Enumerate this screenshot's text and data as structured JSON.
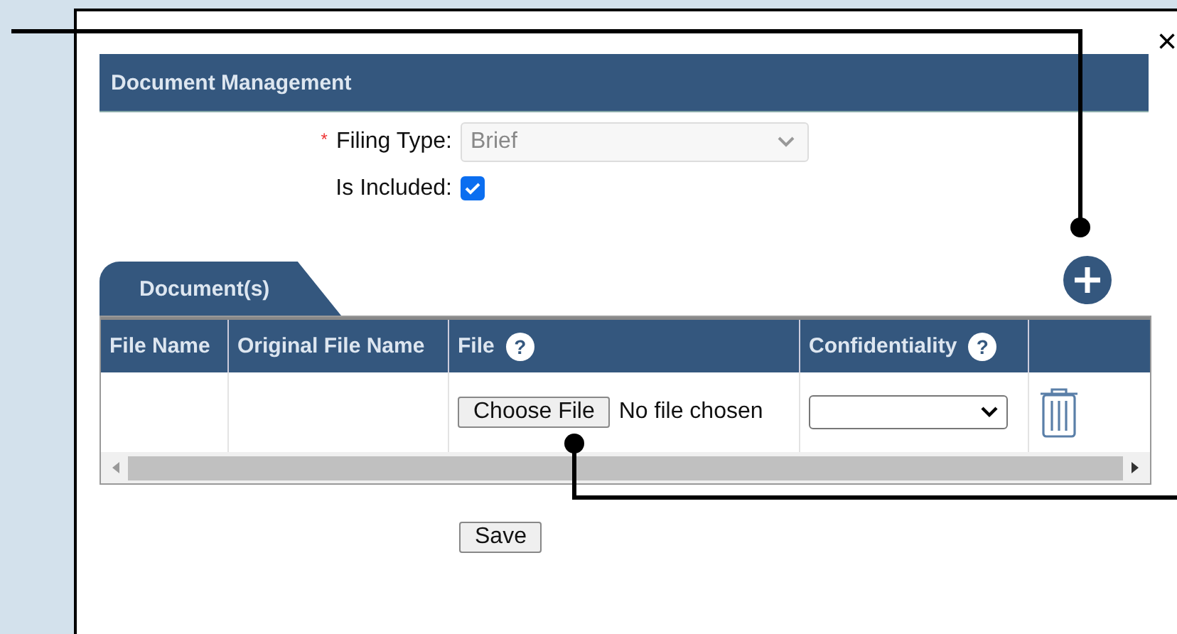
{
  "dialog": {
    "close": "×",
    "title": "Document Management"
  },
  "form": {
    "filing_type": {
      "label": "Filing Type:",
      "required_mark": "*",
      "value": "Brief",
      "disabled": true
    },
    "is_included": {
      "label": "Is Included:",
      "checked": true
    }
  },
  "tabs": [
    {
      "label": "Document(s)",
      "selected": true
    }
  ],
  "table": {
    "columns": [
      {
        "label": "File Name"
      },
      {
        "label": "Original File Name"
      },
      {
        "label": "File",
        "help": "?"
      },
      {
        "label": "Confidentiality",
        "help": "?"
      }
    ],
    "rows": [
      {
        "file_button": "Choose File",
        "file_status": "No file chosen"
      }
    ]
  },
  "save": "Save"
}
